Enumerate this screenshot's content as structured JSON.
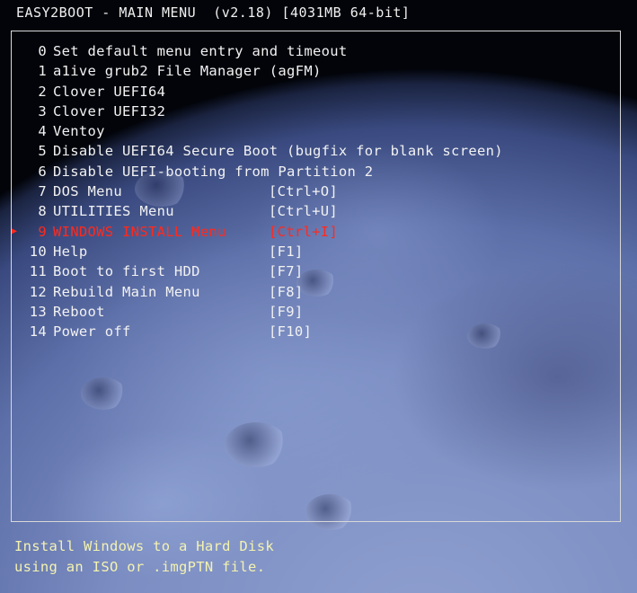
{
  "header": {
    "title": "EASY2BOOT - MAIN MENU  (v2.18) [4031MB 64-bit]"
  },
  "menu": {
    "selected_marker": "▶",
    "items": [
      {
        "num": "0",
        "label": "Set default menu entry and timeout",
        "hotkey": ""
      },
      {
        "num": "1",
        "label": "a1ive grub2 File Manager (agFM)",
        "hotkey": ""
      },
      {
        "num": "2",
        "label": "Clover UEFI64",
        "hotkey": ""
      },
      {
        "num": "3",
        "label": "Clover UEFI32",
        "hotkey": ""
      },
      {
        "num": "4",
        "label": "Ventoy",
        "hotkey": ""
      },
      {
        "num": "5",
        "label": "Disable UEFI64 Secure Boot (bugfix for blank screen)",
        "hotkey": ""
      },
      {
        "num": "6",
        "label": "Disable UEFI-booting from Partition 2",
        "hotkey": ""
      },
      {
        "num": "7",
        "label": "DOS Menu",
        "hotkey": "[Ctrl+O]"
      },
      {
        "num": "8",
        "label": "UTILITIES Menu",
        "hotkey": "[Ctrl+U]"
      },
      {
        "num": "9",
        "label": "WINDOWS INSTALL Menu",
        "hotkey": "[Ctrl+I]"
      },
      {
        "num": "10",
        "label": "Help",
        "hotkey": "[F1]"
      },
      {
        "num": "11",
        "label": "Boot to first HDD",
        "hotkey": "[F7]"
      },
      {
        "num": "12",
        "label": "Rebuild Main Menu",
        "hotkey": "[F8]"
      },
      {
        "num": "13",
        "label": "Reboot",
        "hotkey": "[F9]"
      },
      {
        "num": "14",
        "label": "Power off",
        "hotkey": "[F10]"
      }
    ],
    "selected_index": 9
  },
  "help": {
    "line1": "Install Windows to a Hard Disk",
    "line2": "using an ISO or .imgPTN file."
  },
  "colors": {
    "normal_text": "#f2f2f2",
    "selected_text": "#ff2a1e",
    "help_text": "#f4f2b0",
    "frame": "#d8d8d8"
  }
}
